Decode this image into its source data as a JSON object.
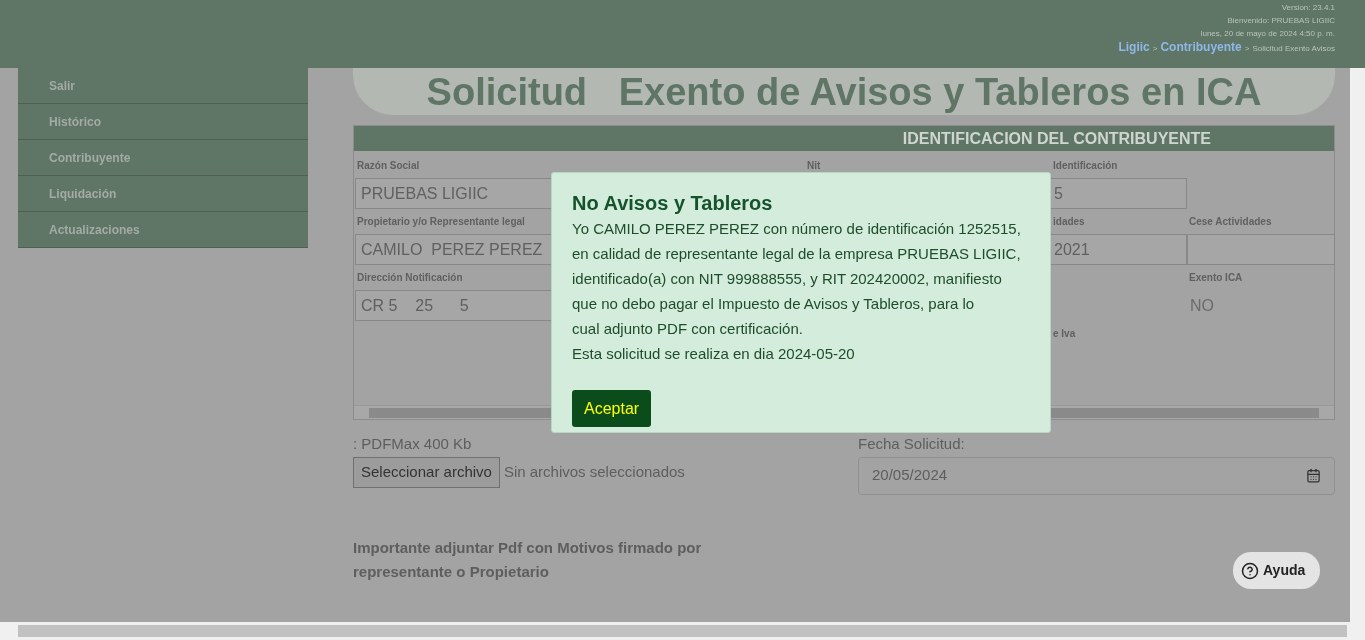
{
  "header": {
    "version": "Version: 23.4.1",
    "welcome": "Bienvenido: PRUEBAS LIGIIC",
    "datetime": "lunes, 20 de mayo de 2024 4:50 p. m.",
    "breadcrumb": [
      {
        "label": "Ligiic",
        "kind": "link"
      },
      {
        "label": ">",
        "kind": "sep"
      },
      {
        "label": "Contribuyente",
        "kind": "link"
      },
      {
        "label": ">",
        "kind": "sep"
      },
      {
        "label": "Solicitud Exento Avisos",
        "kind": "text"
      }
    ]
  },
  "sidebar": {
    "items": [
      "Salir",
      "Histórico",
      "Contribuyente",
      "Liquidación",
      "Actualizaciones"
    ]
  },
  "title": "Solicitud   Exento de Avisos y Tableros en ICA",
  "form": {
    "section": "IDENTIFICACION DEL CONTRIBUYENTE",
    "rows": [
      [
        {
          "label": "Razón Social",
          "value": "PRUEBAS LIGIIC",
          "kind": "input"
        },
        {
          "label": "Nit",
          "kind": "label"
        },
        {
          "label": "Identificación",
          "value": "5",
          "kind": "input"
        },
        {
          "kind": "empty"
        }
      ],
      [
        {
          "label": "Propietario y/o Representante legal",
          "value": "CAMILO  PEREZ PEREZ",
          "kind": "input"
        },
        {
          "kind": "empty"
        },
        {
          "label": "idades",
          "value": "2021",
          "kind": "input"
        },
        {
          "label": "Cese Actividades",
          "kind": "input"
        }
      ],
      [
        {
          "label": "Dirección Notificación",
          "value": "CR 5    25      5",
          "kind": "input"
        },
        {
          "kind": "empty"
        },
        {
          "kind": "empty"
        },
        {
          "label": "Exento ICA",
          "value": "NO",
          "kind": "text"
        }
      ],
      [
        {
          "kind": "empty"
        },
        {
          "kind": "empty"
        },
        {
          "label": "e Iva",
          "kind": "label"
        },
        {
          "kind": "empty"
        }
      ]
    ]
  },
  "upload": {
    "label": ": PDFMax 400 Kb",
    "button": "Seleccionar archivo",
    "status": "Sin archivos seleccionados"
  },
  "date": {
    "label": "Fecha Solicitud:",
    "value": "20/05/2024"
  },
  "note": "Importante adjuntar Pdf con Motivos firmado por representante o Propietario",
  "help": "Ayuda",
  "modal": {
    "title": "No Avisos y Tableros",
    "lines": [
      "Yo CAMILO PEREZ PEREZ con número de identificación 1252515,",
      "en calidad de representante legal de la empresa PRUEBAS LIGIIC,",
      "identificado(a) con NIT 999888555, y RIT 202420002, manifiesto",
      "que no debo pagar el Impuesto de Avisos y Tableros, para lo",
      "cual adjunto PDF con certificación.",
      "Esta solicitud se realiza en dia 2024-05-20"
    ],
    "button": "Aceptar"
  }
}
